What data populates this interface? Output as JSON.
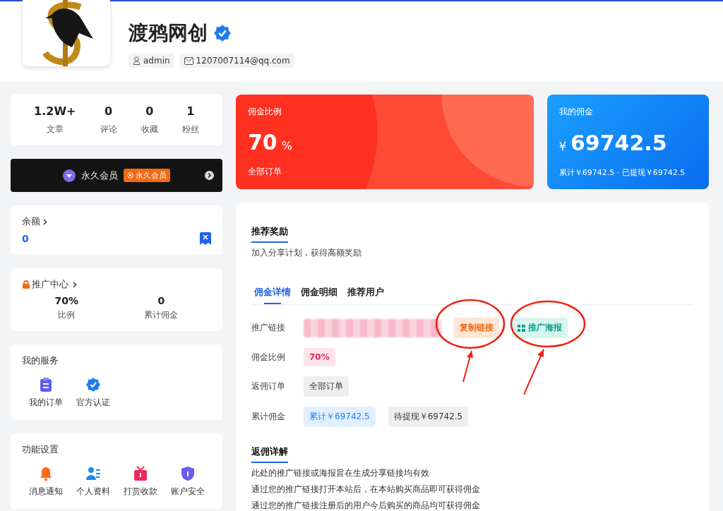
{
  "profile": {
    "name": "渡鸦网创",
    "verified": true,
    "username": "admin",
    "email": "1207007114@qq.com"
  },
  "stats": [
    {
      "value": "1.2W+",
      "label": "文章"
    },
    {
      "value": "0",
      "label": "评论"
    },
    {
      "value": "0",
      "label": "收藏"
    },
    {
      "value": "1",
      "label": "粉丝"
    }
  ],
  "vip": {
    "title": "永久会员",
    "badge": "永久会员"
  },
  "balance": {
    "title": "余额",
    "value": "0"
  },
  "promotion": {
    "title": "推广中心",
    "items": [
      {
        "value": "70%",
        "label": "比例"
      },
      {
        "value": "0",
        "label": "累计佣金"
      }
    ]
  },
  "services": {
    "title": "我的服务",
    "items": [
      {
        "kind": "orders",
        "label": "我的订单"
      },
      {
        "kind": "verified",
        "label": "官方认证"
      }
    ]
  },
  "settings": {
    "title": "功能设置",
    "items": [
      {
        "kind": "bell",
        "label": "消息通知"
      },
      {
        "kind": "profile",
        "label": "个人资料"
      },
      {
        "kind": "gift",
        "label": "打赏收款"
      },
      {
        "kind": "shield",
        "label": "账户安全"
      }
    ]
  },
  "rate_card": {
    "title": "佣金比例",
    "value": "70",
    "unit": "%",
    "footer": "全部订单"
  },
  "commission_card": {
    "title": "我的佣金",
    "currency": "¥",
    "value": "69742.5",
    "footer": "累计￥69742.5 · 已提现￥69742.5"
  },
  "reward": {
    "title": "推荐奖励",
    "subtitle": "加入分享计划，获得高额奖励"
  },
  "tabs": [
    {
      "label": "佣金详情",
      "selected": true
    },
    {
      "label": "佣金明细",
      "selected": false
    },
    {
      "label": "推荐用户",
      "selected": false
    }
  ],
  "details": [
    {
      "label": "推广链接",
      "kind": "link",
      "buttons": [
        {
          "label": "复制链接",
          "kind": "copy"
        },
        {
          "label": "推广海报",
          "kind": "poster"
        }
      ]
    },
    {
      "label": "佣金比例",
      "kind": "tags",
      "tags": [
        {
          "text": "70%",
          "color": "#fde4ea"
        }
      ]
    },
    {
      "label": "返佣订单",
      "kind": "tags",
      "tags": [
        {
          "text": "全部订单",
          "color": "#efefef"
        }
      ]
    },
    {
      "label": "累计佣金",
      "kind": "tags",
      "tags": [
        {
          "text": "累计￥69742.5",
          "color": "#e2efff"
        },
        {
          "text": "待提现￥69742.5",
          "color": "#efefef"
        }
      ]
    }
  ],
  "explain": {
    "title": "返佣详解",
    "lines": [
      "此处的推广链接或海报旨在生成分享链接均有效",
      "通过您的推广链接打开本站后，在本站购买商品即可获得佣金",
      "通过您的推广链接注册后的用户今后购买的商品均可获得佣金"
    ]
  }
}
